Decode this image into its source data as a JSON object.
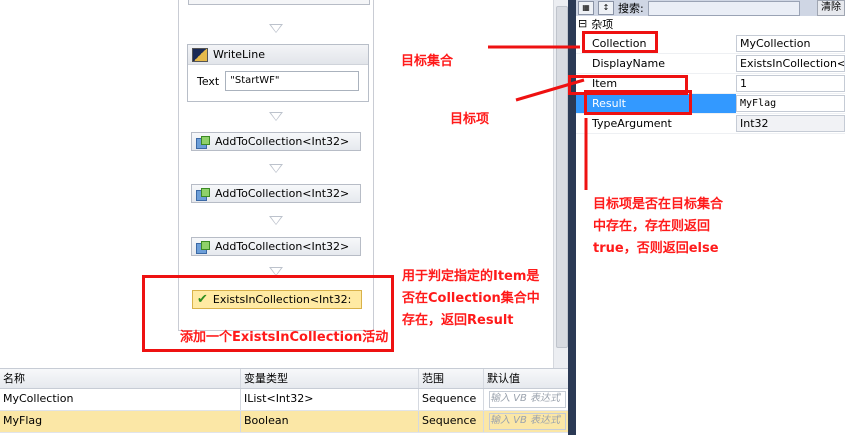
{
  "designer": {
    "writeline": {
      "title": "WriteLine",
      "text_label": "Text",
      "text_value": "\"StartWF\""
    },
    "activities": [
      {
        "label": "AddToCollection<Int32>"
      },
      {
        "label": "AddToCollection<Int32>"
      },
      {
        "label": "AddToCollection<Int32>"
      }
    ],
    "selected_activity": {
      "label": "ExistsInCollection<Int32:"
    }
  },
  "properties": {
    "toolbar": {
      "search_label": "搜索:",
      "clear_label": "清除"
    },
    "category": {
      "toggle": "⊟",
      "name": "杂项"
    },
    "rows": [
      {
        "name": "Collection",
        "value": "MyCollection"
      },
      {
        "name": "DisplayName",
        "value": "ExistsInCollection<"
      },
      {
        "name": "Item",
        "value": "1"
      },
      {
        "name": "Result",
        "value": "MyFlag"
      },
      {
        "name": "TypeArgument",
        "value": "Int32"
      }
    ]
  },
  "variables": {
    "columns": [
      "名称",
      "变量类型",
      "范围",
      "默认值"
    ],
    "rows": [
      {
        "name": "MyCollection",
        "type": "IList<Int32>",
        "scope": "Sequence",
        "default_placeholder": "输入 VB 表达式"
      },
      {
        "name": "MyFlag",
        "type": "Boolean",
        "scope": "Sequence",
        "default_placeholder": "输入 VB 表达式"
      }
    ]
  },
  "annotations": {
    "target_collection": "目标集合",
    "target_item": "目标项",
    "result_note_lines": [
      "目标项是否在目标集合",
      "中存在，存在则返回",
      "true，否则返回else"
    ],
    "item_note_lines": [
      "用于判定指定的Item是",
      "否在Collection集合中",
      "存在，返回Result"
    ],
    "add_activity": "添加一个ExistsInCollection活动"
  },
  "colors": {
    "annotation": "#ff1a1a",
    "selection_blue": "#3399ff",
    "selected_activity": "#ffeaa3",
    "splitter": "#2b3a55"
  }
}
